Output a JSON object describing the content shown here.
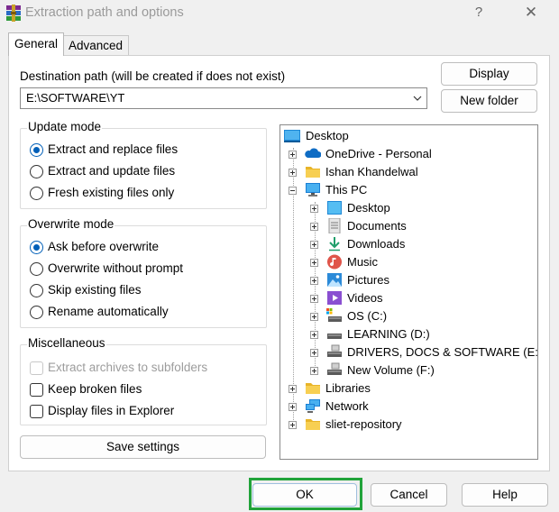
{
  "window": {
    "title": "Extraction path and options",
    "help_glyph": "?",
    "close_glyph": "✕"
  },
  "tabs": [
    {
      "label": "General",
      "active": true
    },
    {
      "label": "Advanced",
      "active": false
    }
  ],
  "destination": {
    "label": "Destination path (will be created if does not exist)",
    "value": "E:\\SOFTWARE\\YT"
  },
  "buttons": {
    "display": "Display",
    "new_folder": "New folder",
    "save_settings": "Save settings",
    "ok": "OK",
    "cancel": "Cancel",
    "help": "Help"
  },
  "update_mode": {
    "title": "Update mode",
    "options": [
      {
        "label": "Extract and replace files",
        "selected": true
      },
      {
        "label": "Extract and update files",
        "selected": false
      },
      {
        "label": "Fresh existing files only",
        "selected": false
      }
    ]
  },
  "overwrite_mode": {
    "title": "Overwrite mode",
    "options": [
      {
        "label": "Ask before overwrite",
        "selected": true
      },
      {
        "label": "Overwrite without prompt",
        "selected": false
      },
      {
        "label": "Skip existing files",
        "selected": false
      },
      {
        "label": "Rename automatically",
        "selected": false
      }
    ]
  },
  "misc": {
    "title": "Miscellaneous",
    "options": [
      {
        "label": "Extract archives to subfolders",
        "checked": false,
        "disabled": true
      },
      {
        "label": "Keep broken files",
        "checked": false,
        "disabled": false
      },
      {
        "label": "Display files in Explorer",
        "checked": false,
        "disabled": false
      }
    ]
  },
  "tree": {
    "items": [
      {
        "label": "Desktop",
        "icon": "desktop-icon"
      },
      {
        "label": "OneDrive - Personal",
        "icon": "cloud-icon"
      },
      {
        "label": "Ishan Khandelwal",
        "icon": "folder-icon"
      },
      {
        "label": "This PC",
        "icon": "monitor-icon"
      },
      {
        "label": "Desktop",
        "icon": "desktop-icon"
      },
      {
        "label": "Documents",
        "icon": "document-icon"
      },
      {
        "label": "Downloads",
        "icon": "download-icon"
      },
      {
        "label": "Music",
        "icon": "music-icon"
      },
      {
        "label": "Pictures",
        "icon": "picture-icon"
      },
      {
        "label": "Videos",
        "icon": "video-icon"
      },
      {
        "label": "OS (C:)",
        "icon": "drive-icon"
      },
      {
        "label": "LEARNING (D:)",
        "icon": "drive-icon"
      },
      {
        "label": "DRIVERS, DOCS & SOFTWARE (E:)",
        "icon": "drive-icon"
      },
      {
        "label": "New Volume (F:)",
        "icon": "drive-icon"
      },
      {
        "label": "Libraries",
        "icon": "folder-icon"
      },
      {
        "label": "Network",
        "icon": "network-icon"
      },
      {
        "label": "sliet-repository",
        "icon": "folder-icon"
      }
    ]
  },
  "colors": {
    "accent": "#005fb8",
    "ok_highlight": "#21a33a",
    "folder": "#f4c542"
  }
}
